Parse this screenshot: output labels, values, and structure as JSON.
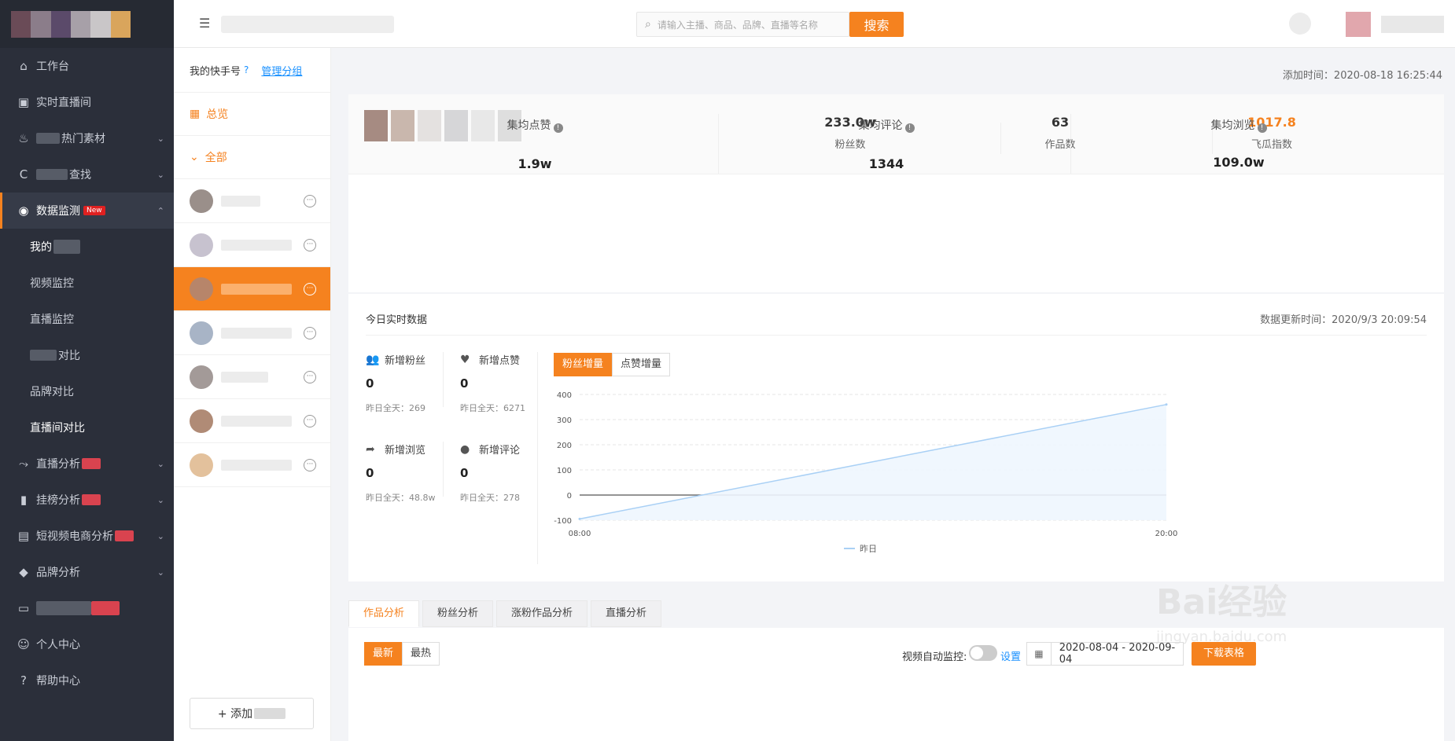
{
  "sidebar": {
    "items": [
      {
        "label": "工作台"
      },
      {
        "label": "实时直播间"
      },
      {
        "label": "热门素材"
      },
      {
        "label": "查找"
      },
      {
        "label": "数据监测",
        "badge": "New"
      },
      {
        "label": "直播分析"
      },
      {
        "label": "挂榜分析"
      },
      {
        "label": "短视频电商分析"
      },
      {
        "label": "品牌分析"
      },
      {
        "label": "个人中心"
      },
      {
        "label": "帮助中心"
      }
    ],
    "sub_items": [
      {
        "label": "我的"
      },
      {
        "label": "视频监控"
      },
      {
        "label": "直播监控"
      },
      {
        "label": "对比"
      },
      {
        "label": "品牌对比"
      },
      {
        "label": "直播间对比"
      }
    ]
  },
  "topbar": {
    "search_placeholder": "请输入主播、商品、品牌、直播等名称",
    "search_button": "搜索"
  },
  "accounts": {
    "title": "我的快手号",
    "help": "?",
    "manage": "管理分组",
    "overview": "总览",
    "all": "全部",
    "add": "+ 添加"
  },
  "profile": {
    "added_label": "添加时间：",
    "added_time": "2020-08-18 16:25:44",
    "fans": "233.0w",
    "fans_label": "粉丝数",
    "works": "63",
    "works_label": "作品数",
    "index": "1017.8",
    "index_label": "飞瓜指数",
    "avg_like_label": "集均点赞",
    "avg_like": "1.9w",
    "avg_comment_label": "集均评论",
    "avg_comment": "1344",
    "avg_view_label": "集均浏览",
    "avg_view": "109.0w"
  },
  "realtime": {
    "title": "今日实时数据",
    "updated_label": "数据更新时间：",
    "updated": "2020/9/3 20:09:54",
    "metrics": [
      {
        "label": "新增粉丝",
        "value": "0",
        "yesterday": "昨日全天：269",
        "icon": "users-icon"
      },
      {
        "label": "新增点赞",
        "value": "0",
        "yesterday": "昨日全天：6271",
        "icon": "heart-icon"
      },
      {
        "label": "新增浏览",
        "value": "0",
        "yesterday": "昨日全天：48.8w",
        "icon": "share-icon"
      },
      {
        "label": "新增评论",
        "value": "0",
        "yesterday": "昨日全天：278",
        "icon": "comment-icon"
      }
    ],
    "tabs": [
      "粉丝增量",
      "点赞增量"
    ]
  },
  "chart_data": {
    "type": "line",
    "x": [
      "08:00",
      "20:00"
    ],
    "series": [
      {
        "name": "昨日",
        "values": [
          -95,
          360
        ]
      }
    ],
    "ylim": [
      -100,
      400
    ],
    "yticks": [
      400,
      300,
      200,
      100,
      0,
      -100
    ],
    "grid": true,
    "legend": "bottom",
    "colors": {
      "line": "#a9d0f5",
      "fill": "#eef6fe",
      "zero": "#555555"
    }
  },
  "bottom": {
    "tabs": [
      "作品分析",
      "粉丝分析",
      "涨粉作品分析",
      "直播分析"
    ],
    "sort": [
      "最新",
      "最热"
    ],
    "monitor_label": "视频自动监控:",
    "settings": "设置",
    "date_range": "2020-08-04 - 2020-09-04",
    "download": "下载表格"
  },
  "watermark": {
    "text": "Bai经验",
    "sub": "jingyan.baidu.com"
  }
}
